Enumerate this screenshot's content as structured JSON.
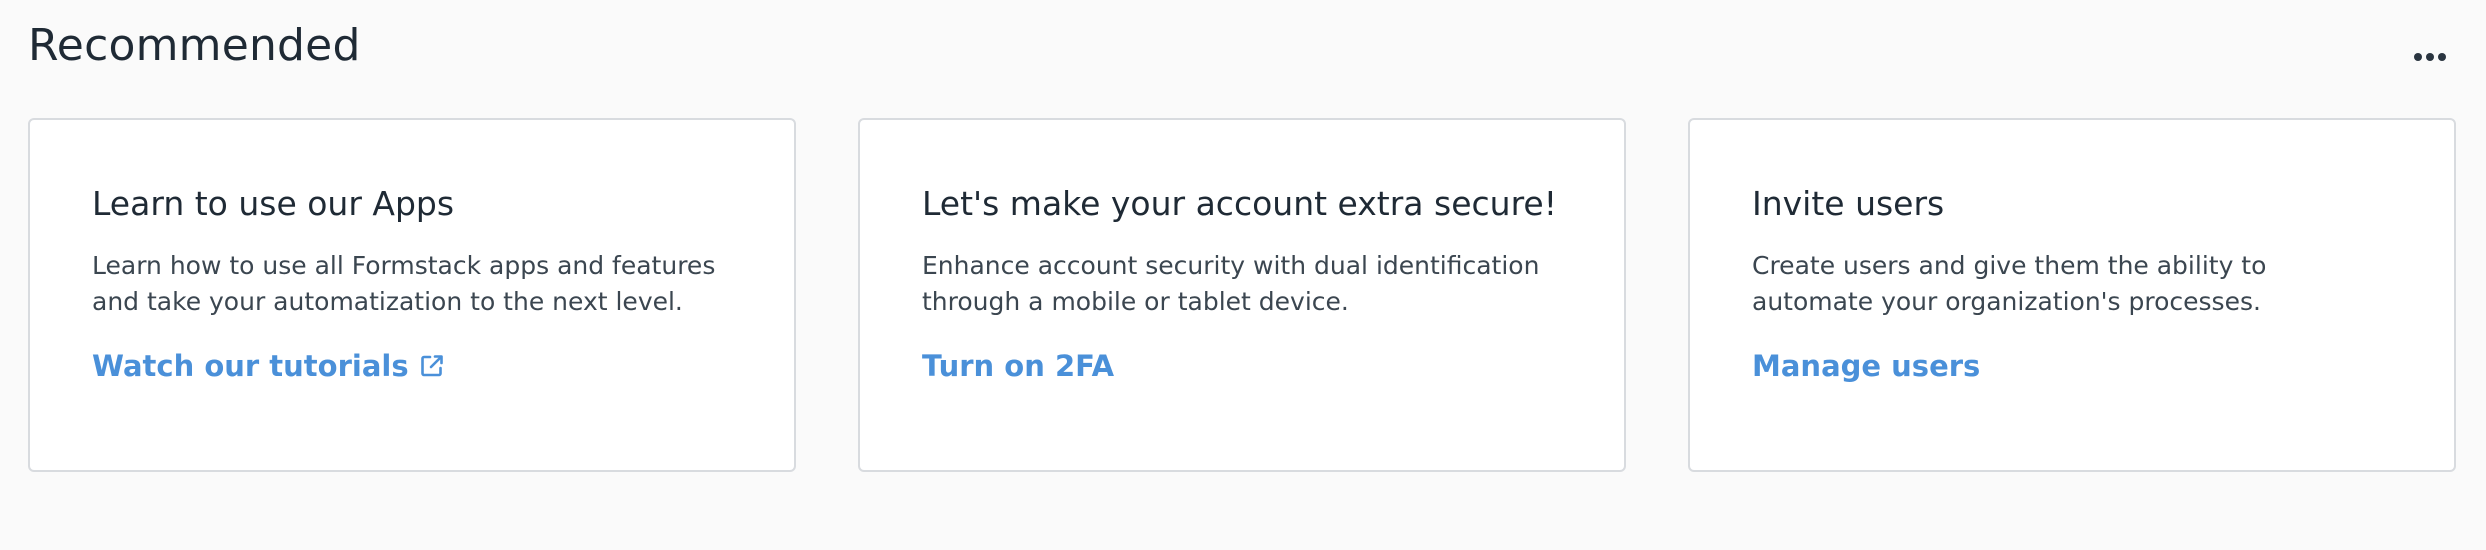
{
  "header": {
    "title": "Recommended",
    "more_icon": "ellipsis-icon"
  },
  "colors": {
    "link": "#4a90d9",
    "title_text": "#1f2a35",
    "body_text": "#3b4650",
    "card_border": "#d8dbdf",
    "page_bg": "#fafafa"
  },
  "cards": [
    {
      "title": "Learn to use our Apps",
      "description": "Learn how to use all Formstack apps and features and take your automatization to the next level.",
      "link_label": "Watch our tutorials",
      "link_icon": "external-link-icon"
    },
    {
      "title": "Let's make your account extra secure!",
      "description": "Enhance account security with dual identification through a mobile or tablet device.",
      "link_label": "Turn on 2FA"
    },
    {
      "title": "Invite users",
      "description": "Create users and give them the ability to automate your organization's processes.",
      "link_label": "Manage users"
    }
  ]
}
